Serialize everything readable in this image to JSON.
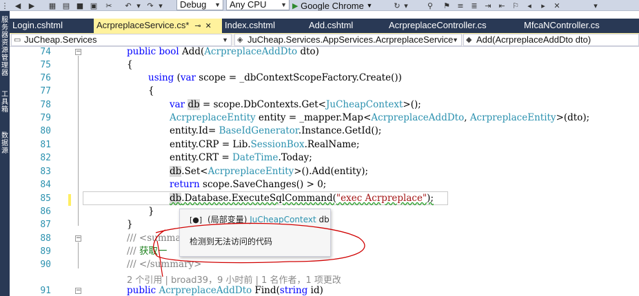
{
  "toolbar": {
    "config": "Debug",
    "platform": "Any CPU",
    "run_target": "Google Chrome"
  },
  "sidebar": {
    "panels": [
      "服务器资源管理器",
      "工具箱",
      "数据源"
    ]
  },
  "tabs": [
    {
      "label": "Login.cshtml",
      "active": false
    },
    {
      "label": "AcrpreplaceService.cs*",
      "active": true
    },
    {
      "label": "Index.cshtml",
      "active": false
    },
    {
      "label": "Add.cshtml",
      "active": false
    },
    {
      "label": "AcrpreplaceController.cs",
      "active": false
    },
    {
      "label": "MfcaNController.cs",
      "active": false
    }
  ],
  "navbar": {
    "project": "JuCheap.Services",
    "type": "JuCheap.Services.AppServices.AcrpreplaceService",
    "member": "Add(AcrpreplaceAddDto dto)"
  },
  "editor": {
    "line_numbers": [
      "74",
      "75",
      "76",
      "77",
      "78",
      "79",
      "80",
      "81",
      "82",
      "83",
      "84",
      "85",
      "86",
      "87",
      "88",
      "89",
      "90",
      "91"
    ],
    "lines": {
      "l74": {
        "a": "public",
        "b": "bool",
        "c": "Add(",
        "d": "AcrpreplaceAddDto",
        "e": "dto)"
      },
      "l75": "{",
      "l76": {
        "a": "using",
        "b": "(",
        "c": "var",
        "d": "scope = _dbContextScopeFactory.Create())"
      },
      "l77": "{",
      "l78": {
        "a": "var",
        "b": "db",
        "c": "= scope.DbContexts.Get<",
        "d": "JuCheapContext",
        "e": ">();"
      },
      "l79": {
        "a": "AcrpreplaceEntity",
        "b": "entity = _mapper.Map<",
        "c": "AcrpreplaceAddDto",
        "d": ",",
        "e": "AcrpreplaceEntity",
        "f": ">(dto);"
      },
      "l80": {
        "a": "entity.Id=",
        "b": "BaseIdGenerator",
        "c": ".Instance.GetId();"
      },
      "l81": {
        "a": "entity.CRP = Lib.",
        "b": "SessionBox",
        "c": ".RealName;"
      },
      "l82": {
        "a": "entity.CRT =",
        "b": "DateTime",
        "c": ".Today;"
      },
      "l83": {
        "a": "db",
        "b": ".Set<",
        "c": "AcrpreplaceEntity",
        "d": ">().Add(entity);"
      },
      "l84": {
        "a": "return",
        "b": "scope.SaveChanges() > 0;"
      },
      "l85": {
        "a": "db",
        "b": ".Database.ExecuteSqlCommand(",
        "c": "\"exec Acrpreplace\"",
        "d": ");"
      },
      "l86": "}",
      "l87": "}",
      "l88": "/// <summa",
      "l89": {
        "a": "/// ",
        "b": "获取一"
      },
      "l90": "/// </summary>",
      "l91": {
        "a": "public",
        "b": "AcrpreplaceAddDto",
        "c": "Find(",
        "d": "string",
        "e": "id)"
      }
    },
    "codelens": "2 个引用 | broad39，9 小时前 | 1 名作者，1 项更改"
  },
  "tooltip": {
    "scope": "(局部变量)",
    "type": "JuCheapContext",
    "name": "db",
    "message": "检测到无法访问的代码"
  },
  "colors": {
    "keyword": "#0000ff",
    "type": "#2b91af",
    "string": "#a31515",
    "comment": "#808080",
    "annotation": "#d00000"
  }
}
